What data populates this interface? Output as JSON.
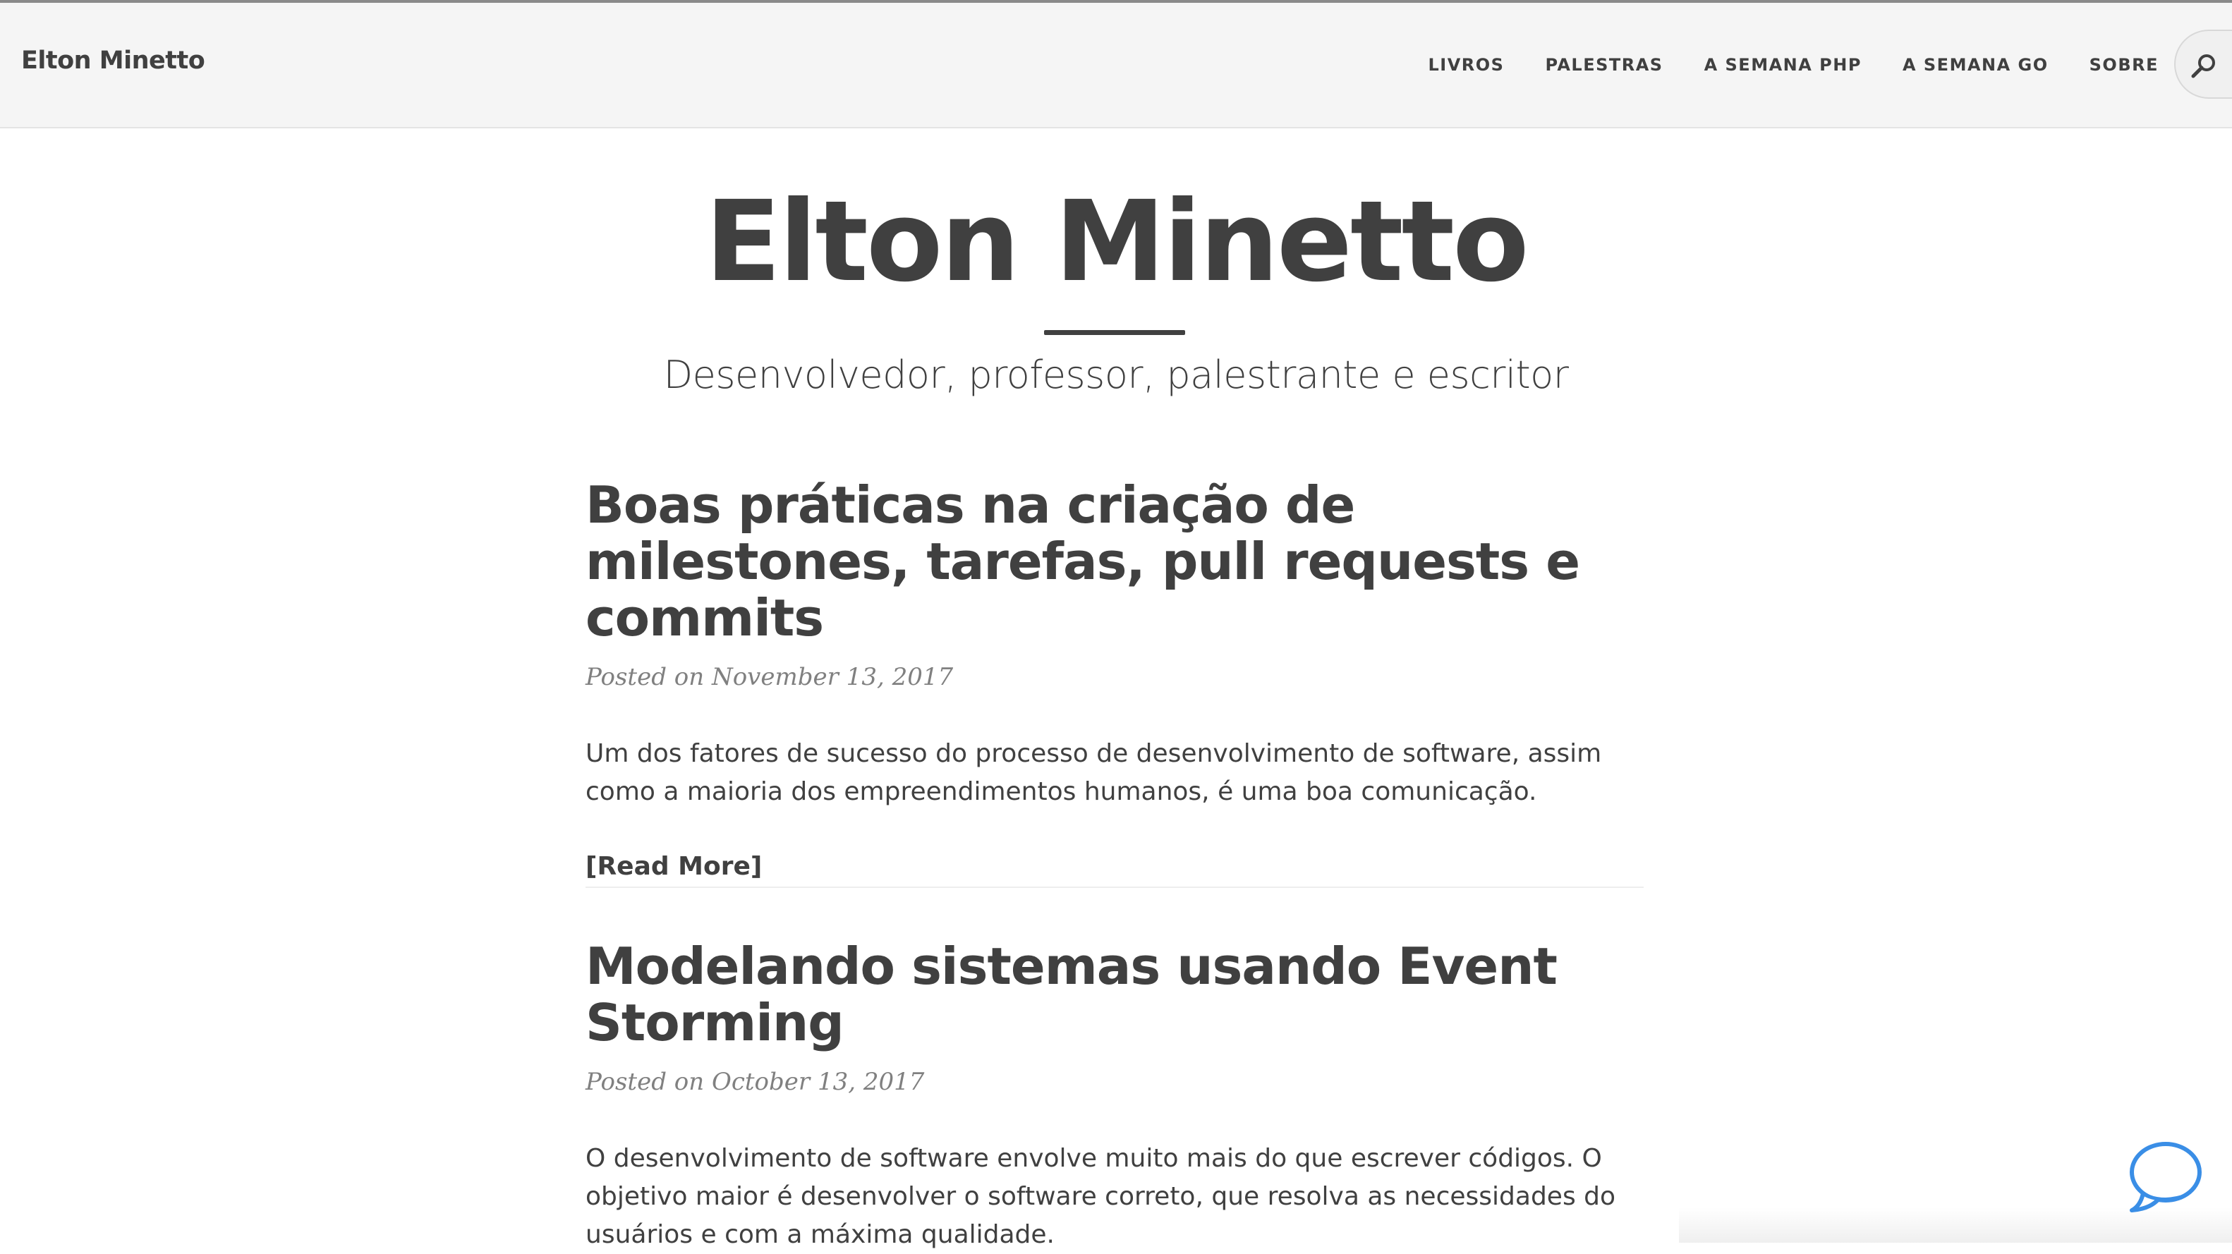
{
  "navbar": {
    "brand": "Elton Minetto",
    "items": [
      {
        "label": "LIVROS"
      },
      {
        "label": "PALESTRAS"
      },
      {
        "label": "A SEMANA PHP"
      },
      {
        "label": "A SEMANA GO"
      },
      {
        "label": "SOBRE"
      }
    ],
    "search_icon": "search-icon"
  },
  "header": {
    "title": "Elton Minetto",
    "subtitle": "Desenvolvedor, professor, palestrante e escritor"
  },
  "posts": [
    {
      "title": "Boas práticas na criação de milestones, tarefas, pull requests e commits",
      "meta": "Posted on November 13, 2017",
      "excerpt": "Um dos fatores de sucesso do processo de desenvolvimento de software, assim como a maioria dos empreendimentos humanos, é uma boa comunicação.",
      "read_more": "[Read More]"
    },
    {
      "title": "Modelando sistemas usando Event Storming",
      "meta": "Posted on October 13, 2017",
      "excerpt": "O desenvolvimento de software envolve muito mais do que escrever códigos. O objetivo maior é desenvolver o software correto, que resolva as necessidades do usuários e com a máxima qualidade."
    }
  ],
  "chat_widget": {
    "icon": "chat-bubble-icon"
  },
  "colors": {
    "text": "#404040",
    "meta": "#808080",
    "navbar_bg": "#f5f5f5",
    "chat_accent": "#3a8ee6"
  }
}
